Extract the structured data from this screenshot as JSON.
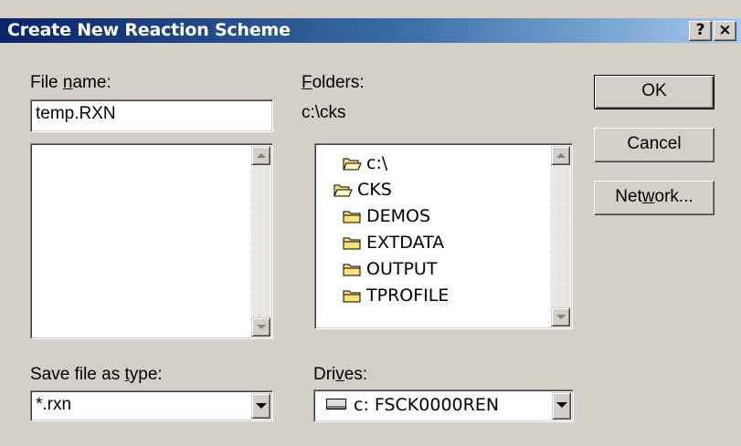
{
  "window": {
    "title": "Create New Reaction Scheme",
    "help_glyph": "?",
    "close_glyph": "×"
  },
  "file_name": {
    "label_before": "File ",
    "label_mnemonic": "n",
    "label_after": "ame:",
    "value": "temp.RXN"
  },
  "file_list": {
    "items": []
  },
  "folders": {
    "label_before": "",
    "label_mnemonic": "F",
    "label_after": "olders:",
    "current_path": "c:\\cks",
    "tree": [
      {
        "name": "c:\\",
        "icon": "open-folder-icon"
      },
      {
        "name": "CKS",
        "icon": "open-folder-icon"
      },
      {
        "name": "DEMOS",
        "icon": "folder-icon"
      },
      {
        "name": "EXTDATA",
        "icon": "folder-icon"
      },
      {
        "name": "OUTPUT",
        "icon": "folder-icon"
      },
      {
        "name": "TPROFILE",
        "icon": "folder-icon"
      }
    ]
  },
  "save_type": {
    "label_before": "Save file as ",
    "label_mnemonic": "t",
    "label_after": "ype:",
    "value": "*.rxn"
  },
  "drives": {
    "label_before": "Dri",
    "label_mnemonic": "v",
    "label_after": "es:",
    "value": "c: FSCK0000REN",
    "icon": "drive-icon"
  },
  "buttons": {
    "ok": "OK",
    "cancel": "Cancel",
    "network_before": "Net",
    "network_mnemonic": "w",
    "network_after": "ork..."
  },
  "colors": {
    "titlebar_start": "#0a246a",
    "titlebar_end": "#a6caf0",
    "face": "#d4d0c8",
    "folder_yellow": "#f8e07a"
  }
}
